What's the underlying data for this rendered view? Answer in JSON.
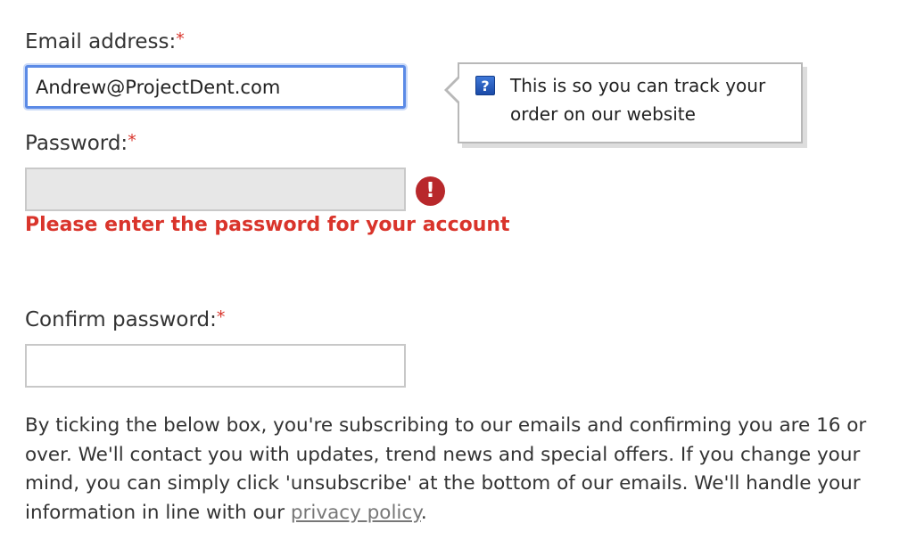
{
  "form": {
    "email": {
      "label": "Email address:",
      "required_marker": "*",
      "value": "Andrew@ProjectDent.com"
    },
    "email_tooltip": {
      "icon": "help-icon",
      "text": "This is so you can track your order on our website"
    },
    "password": {
      "label": "Password:",
      "required_marker": "*",
      "value": "",
      "error_icon": "exclamation-icon",
      "error_message": "Please enter the password for your account"
    },
    "confirm_password": {
      "label": "Confirm password:",
      "required_marker": "*",
      "value": ""
    },
    "consent": {
      "text": "By ticking the below box, you're subscribing to our emails and confirming you are 16 or over. We'll contact you with updates, trend news and special offers. If you change your mind, you can simply click 'unsubscribe' at the bottom of our emails. We'll handle your information in line with our ",
      "link_text": "privacy policy",
      "trailing": "."
    }
  },
  "colors": {
    "required": "#d9342b",
    "error_text": "#d9342b",
    "error_icon_bg": "#b8282b",
    "focus_border": "#5b8ae6",
    "link": "#777777"
  }
}
